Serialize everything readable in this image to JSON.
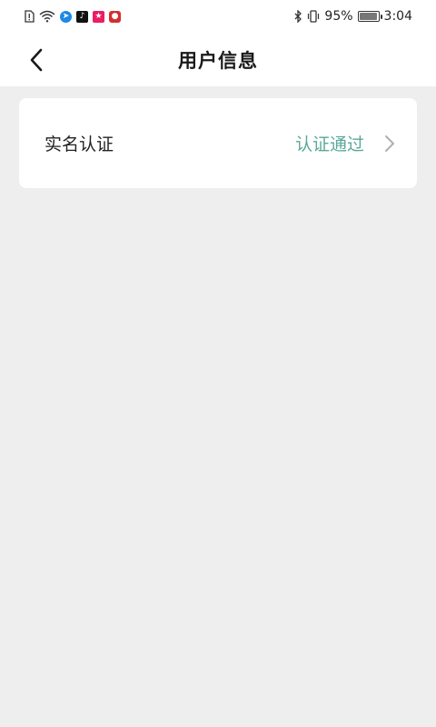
{
  "status_bar": {
    "battery": "95%",
    "time": "3:04",
    "app_colors": [
      "#1e88e5",
      "#111111",
      "#e91e63",
      "#d32f2f"
    ]
  },
  "header": {
    "title": "用户信息",
    "back_icon": "chevron-left-icon"
  },
  "settings": {
    "items": [
      {
        "label": "实名认证",
        "value": "认证通过",
        "value_color": "#5aa99a",
        "icon": "chevron-right-icon"
      }
    ]
  }
}
